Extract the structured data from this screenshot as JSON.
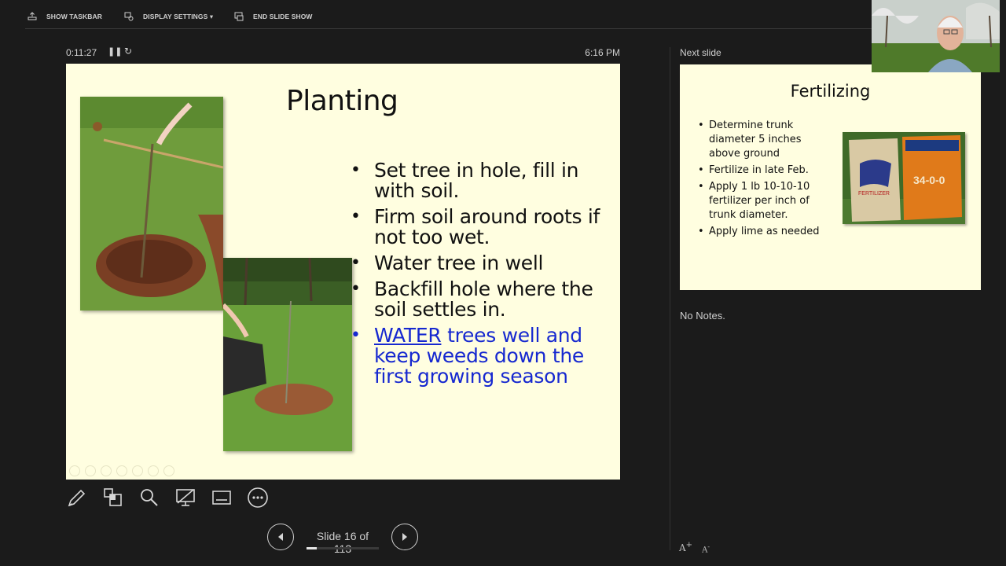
{
  "toolbar": {
    "show_taskbar": "SHOW TASKBAR",
    "display_settings": "DISPLAY SETTINGS ▾",
    "end_slide_show": "END SLIDE SHOW"
  },
  "presenter": {
    "elapsed_time": "0:11:27",
    "clock": "6:16 PM",
    "slide_counter": "Slide 16 of 113",
    "progress": 0.14
  },
  "current_slide": {
    "title": "Planting",
    "bullets": [
      "Set tree in hole, fill in with soil.",
      "Firm soil around roots if not too wet.",
      "Water tree in well",
      "Backfill hole where the soil settles in."
    ],
    "highlight_bullet": {
      "underlined": "WATER",
      "rest": " trees well and keep weeds down the first growing season",
      "color": "#1628d0"
    }
  },
  "next_slide": {
    "label": "Next slide",
    "title": "Fertilizing",
    "bullets": [
      "Determine trunk diameter 5 inches above ground",
      "Fertilize in late Feb.",
      "Apply 1 lb 10-10-10 fertilizer per inch of trunk diameter.",
      "Apply lime as needed"
    ],
    "bag_labels": [
      "FERTILIZER",
      "34-0-0"
    ]
  },
  "notes": {
    "text": "No Notes."
  },
  "colors": {
    "background": "#1b1b1b",
    "slide_bg": "#fffee0",
    "accent_blue": "#1628d0"
  }
}
